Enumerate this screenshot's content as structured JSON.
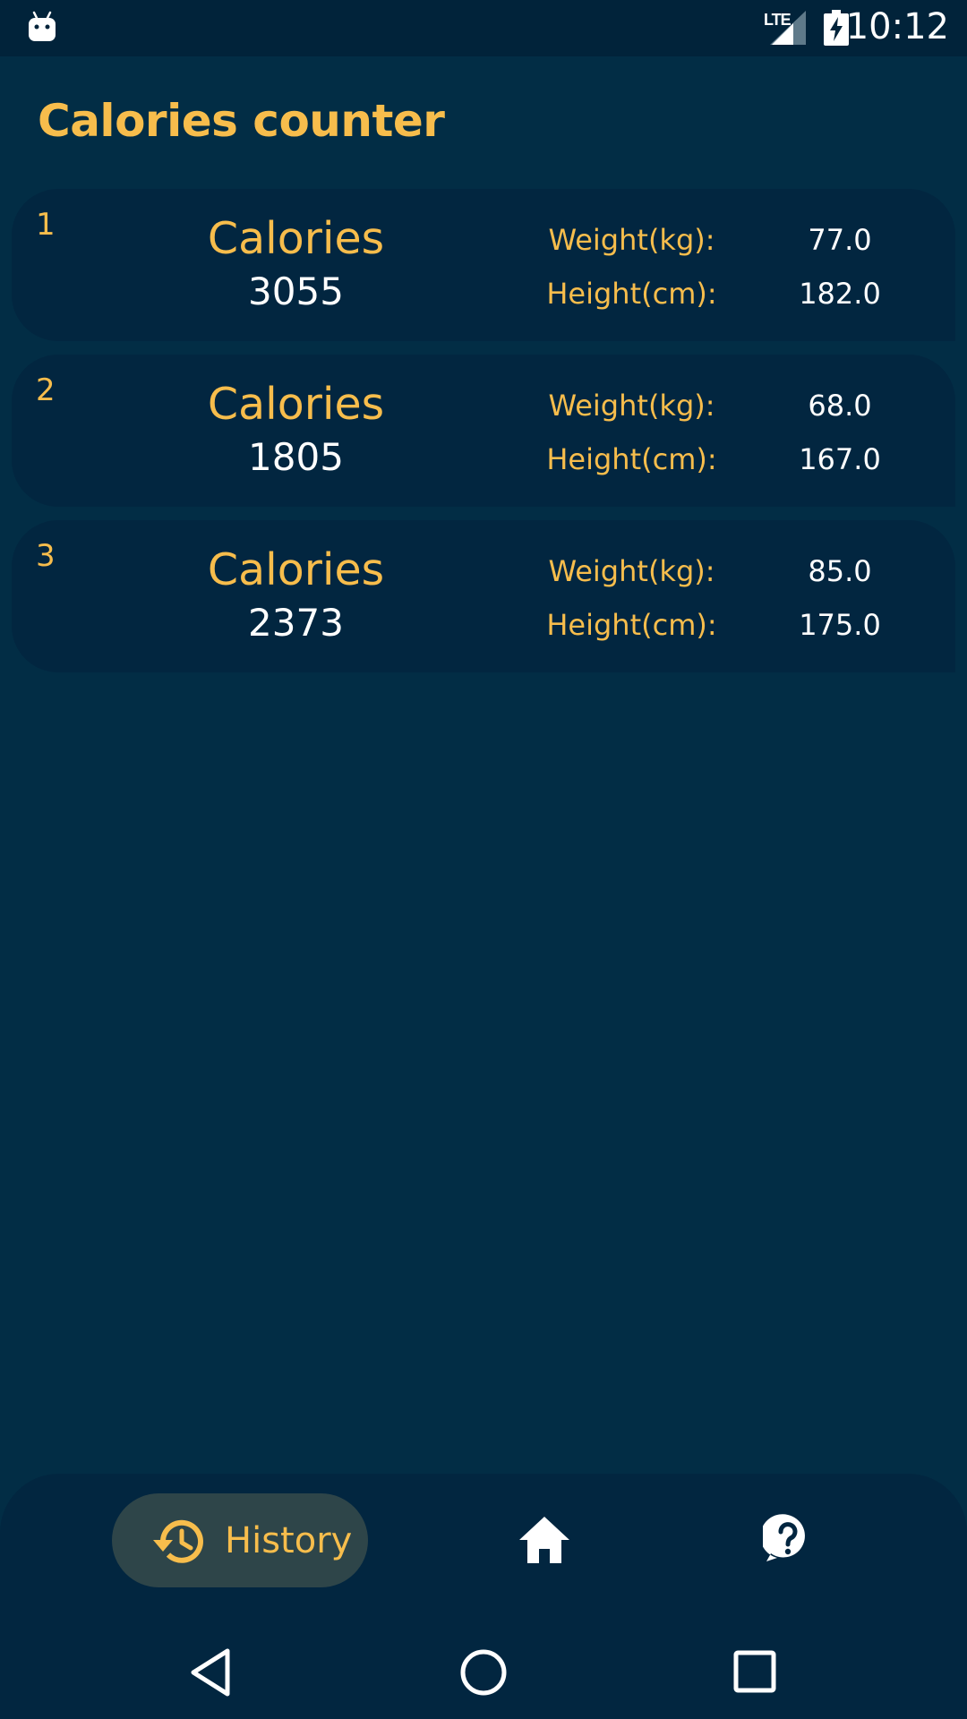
{
  "status_bar": {
    "network": "LTE",
    "time": "10:12",
    "icons": [
      "android-debug-icon",
      "signal-icon",
      "battery-charging-icon"
    ]
  },
  "app": {
    "title": "Calories counter"
  },
  "history": [
    {
      "index": "1",
      "calories_label": "Calories",
      "calories": "3055",
      "weight_label": "Weight(kg):",
      "weight": "77.0",
      "height_label": "Height(cm):",
      "height": "182.0"
    },
    {
      "index": "2",
      "calories_label": "Calories",
      "calories": "1805",
      "weight_label": "Weight(kg):",
      "weight": "68.0",
      "height_label": "Height(cm):",
      "height": "167.0"
    },
    {
      "index": "3",
      "calories_label": "Calories",
      "calories": "2373",
      "weight_label": "Weight(kg):",
      "weight": "85.0",
      "height_label": "Height(cm):",
      "height": "175.0"
    }
  ],
  "bottom_nav": {
    "items": [
      {
        "label": "History",
        "icon": "history-icon",
        "selected": true
      },
      {
        "icon": "home-icon",
        "selected": false
      },
      {
        "icon": "help-icon",
        "selected": false
      }
    ]
  },
  "system_nav": {
    "icons": [
      "back-icon",
      "home-circle-icon",
      "recents-icon"
    ]
  },
  "colors": {
    "background": "#022d45",
    "card": "#022640",
    "accent": "#f7bd4c",
    "text": "#ffffff",
    "selected_pill": "#2e4549"
  }
}
